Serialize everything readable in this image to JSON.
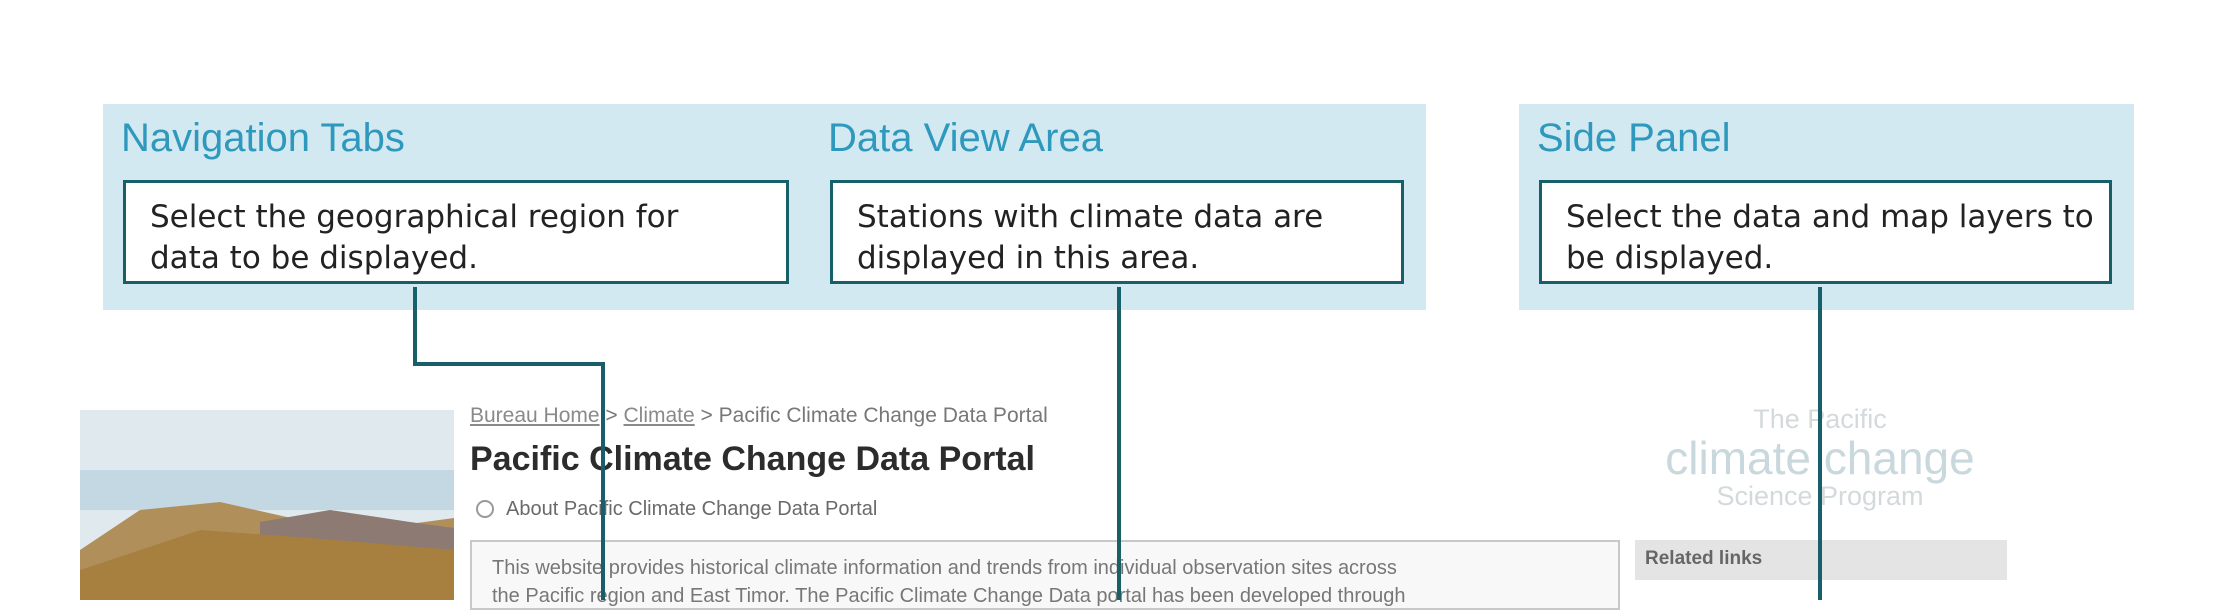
{
  "callouts": [
    {
      "title": "Navigation Tabs",
      "line1": "Select the geographical region for",
      "line2": "data to be displayed."
    },
    {
      "title": "Data View Area",
      "line1": "Stations with climate data are",
      "line2": "displayed in this area."
    },
    {
      "title": "Side Panel",
      "line1": "Select the data and map layers to",
      "line2": "be displayed."
    }
  ],
  "portal": {
    "breadcrumb": {
      "home": "Bureau Home",
      "sep1": " > ",
      "climate": "Climate",
      "sep2": " > ",
      "current": "Pacific Climate Change Data Portal"
    },
    "title": "Pacific Climate Change Data Portal",
    "about_link": "About Pacific Climate Change Data Portal",
    "intro_line1": "This website provides historical climate information and trends from individual observation sites across",
    "intro_line2": "the Pacific region and East Timor. The Pacific Climate Change Data portal has been developed through",
    "logo": {
      "top": "The Pacific",
      "mid": "climate change",
      "bot": "Science Program"
    },
    "related_label": "Related links"
  },
  "colors": {
    "callout_bg": "#d2e9f1",
    "callout_title": "#2f98bd",
    "connector": "#17606a"
  }
}
